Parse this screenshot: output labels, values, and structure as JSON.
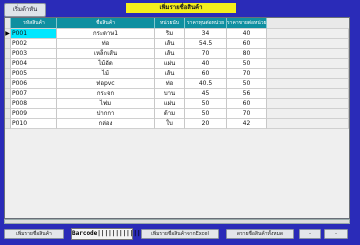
{
  "top_button": "เริ่มต้าหัน",
  "title": "เพิ่มรายชื่อสินค้า",
  "columns": [
    "รหัสสินค้า",
    "ชื่อสินค้า",
    "หน่วยนับ",
    "ราคาทุนต่อหน่วย",
    "ราคาขายต่อหน่วย"
  ],
  "rows": [
    {
      "id": "P001",
      "name": "กระดาษ1",
      "unit": "ริม",
      "cost": "34",
      "price": "40"
    },
    {
      "id": "P002",
      "name": "ท่อ",
      "unit": "เส้น",
      "cost": "54.5",
      "price": "60"
    },
    {
      "id": "P003",
      "name": "เหล็กเส้น",
      "unit": "เส้น",
      "cost": "70",
      "price": "80"
    },
    {
      "id": "P004",
      "name": "ไม้อัด",
      "unit": "แผ่น",
      "cost": "40",
      "price": "50"
    },
    {
      "id": "P005",
      "name": "ไม้",
      "unit": "เส้น",
      "cost": "60",
      "price": "70"
    },
    {
      "id": "P006",
      "name": "ท่อpvc",
      "unit": "ท่อ",
      "cost": "40.5",
      "price": "50"
    },
    {
      "id": "P007",
      "name": "กระจก",
      "unit": "บาน",
      "cost": "45",
      "price": "56"
    },
    {
      "id": "P008",
      "name": "ไฟม",
      "unit": "แผ่น",
      "cost": "50",
      "price": "60"
    },
    {
      "id": "P009",
      "name": "ปากกา",
      "unit": "ด้าม",
      "cost": "50",
      "price": "70"
    },
    {
      "id": "P010",
      "name": "กล่อง",
      "unit": "ใบ",
      "cost": "20",
      "price": "42"
    }
  ],
  "row_pointer": "▶",
  "buttons": {
    "add": "เพิ่มรายชื่อสินค้า",
    "barcode": "Barcode|||||||||||||||",
    "import_excel": "เพิ่มรายชื่อสินค้าจากExcel",
    "export_all": "ดรายชื่อสินค้าทั้งหมด",
    "dash": "-"
  }
}
